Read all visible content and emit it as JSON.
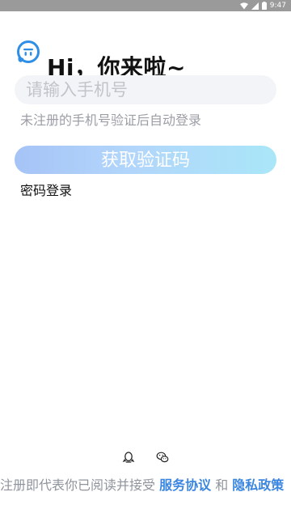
{
  "status_bar": {
    "time": "9:47"
  },
  "header": {
    "greeting": "Hi，你来啦~"
  },
  "phone": {
    "placeholder": "请输入手机号",
    "hint": "未注册的手机号验证后自动登录"
  },
  "actions": {
    "get_code_label": "获取验证码",
    "password_login_label": "密码登录"
  },
  "social": {
    "icons": [
      "qq-icon",
      "wechat-icon"
    ]
  },
  "agreement": {
    "prefix": "注册即代表你已阅读并接受 ",
    "service_link": "服务协议",
    "connector": " 和 ",
    "privacy_link": "隐私政策"
  },
  "colors": {
    "accent": "#3b86e0",
    "button_gradient_start": "#a6c3f6",
    "button_gradient_end": "#a9e6f8",
    "hint_text": "#9b9ea6",
    "status_bar": "#9a9a9a"
  }
}
